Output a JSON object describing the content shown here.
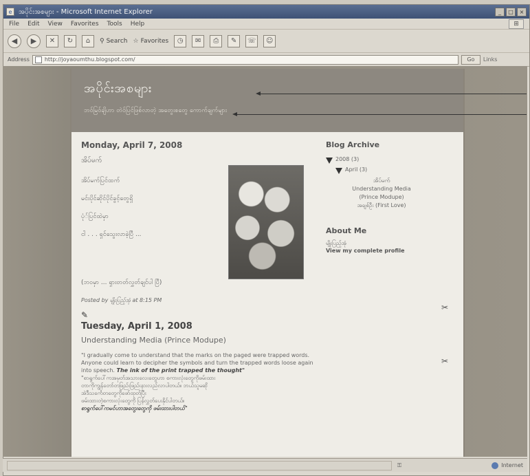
{
  "window": {
    "title": "အပိုင်းအစများ - Microsoft Internet Explorer",
    "controls": [
      "_",
      "□",
      "×"
    ]
  },
  "menubar": [
    "File",
    "Edit",
    "View",
    "Favorites",
    "Tools",
    "Help"
  ],
  "toolbar": {
    "search_label": "Search",
    "favorites_label": "Favorites"
  },
  "address": {
    "label": "Address",
    "url": "http://joyaoumthu.blogspot.com/",
    "go_label": "Go",
    "links_label": "Links"
  },
  "blog": {
    "title": "အပိုင်းအစများ",
    "description": "ဘဝ်မြဝ်ချိဟာ တဲဝ်ပြင်ဖြစ်လာတဲ့ အတွေးစတွေ ကောက်ချက်များ"
  },
  "posts": [
    {
      "date": "Monday, April 7, 2008",
      "title": "အိပ်မက်",
      "lines": [
        "အိပ်မက်ပြင်ထက်",
        "မင်းပိုင်ဆိုင်ပိုင်ခွင့်တွေရှိ",
        "ပုံ်ပြင်ထဲမှာ",
        "ငါ . . . ရှင်သွေးလာခဲ့ပြီ ...",
        "(ဘဝမှာ ... ရှားတတ်လွှတ်ချင်ပါ ပြီ)"
      ],
      "posted_by": "Posted by မျိုးပြည့်အုံ at 8:15 PM"
    },
    {
      "date": "Tuesday, April 1, 2008",
      "title": "Understanding Media (Prince Modupe)",
      "quote": "\"I gradually come to understand that the marks on the paged were trapped words. Anyone could learn to decipher the symbols and turn the trapped words loose again into speech.",
      "quote_bold": "The ink of the print trapped the thought\"",
      "my_lines": [
        "\"စာရွက်ပေါ်ကအမှတ်အသားလေးတွေဟာ စကားလုံးတွေကိုဖမ်းထား",
        "တာကိုကျွန်တော်တဖြည်းဖြည်းနားလည်လာပါတယ်။ ဘယ်သူမဆို",
        "အဲဒီသင်္ကေတတွေကိုဖော်ထုတ်ပြီး",
        "ဖမ်းထားတဲ့စကားလုံးတွေကို ပြန်လွှတ်ပေးနိုင်ပါတယ်။"
      ],
      "my_bold": "စာရွက်ပေါ်ကမင်ဟာအတွေးတွေကို ဖမ်းထားပါတယ်\""
    }
  ],
  "sidebar": {
    "archive_head": "Blog Archive",
    "year": "2008 (3)",
    "month": "April (3)",
    "items": [
      "အိပ်မက်",
      "Understanding Media",
      "(Prince Modupe)",
      "အချစ်ဦး (First Love)"
    ],
    "about_head": "About Me",
    "about_name": "မျိုးပြည့်အုံ",
    "profile_link": "View my complete profile"
  },
  "status": {
    "zone": "Internet"
  },
  "colors": {
    "header_bg": "#8d8880",
    "page_bg": "#efede7",
    "titlebar": "#3f5275"
  }
}
